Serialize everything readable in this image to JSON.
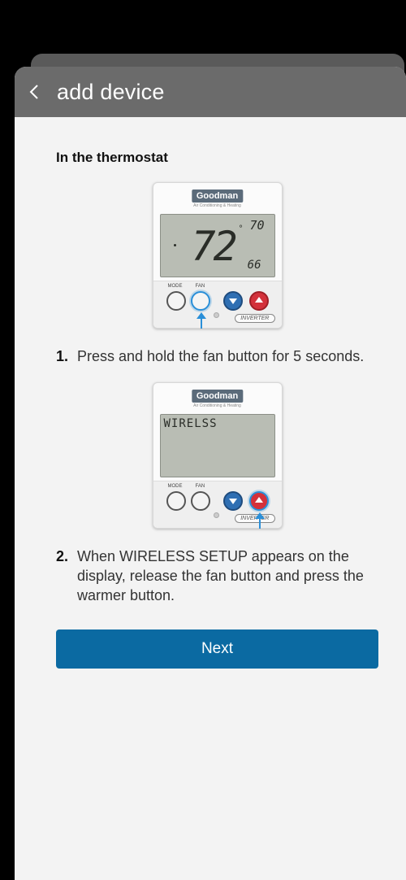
{
  "header": {
    "title": "add device",
    "back_icon": "chevron-left-icon"
  },
  "section_title": "In the thermostat",
  "thermostat_1": {
    "brand": "Goodman",
    "brand_sub": "Air Conditioning & Heating",
    "current_temp": "72",
    "set_high": "70",
    "set_low": "66",
    "mode_label": "MODE",
    "fan_label": "FAN",
    "badge": "INVERTER"
  },
  "step_1": {
    "number": "1.",
    "text": "Press and hold the fan button for 5 seconds."
  },
  "thermostat_2": {
    "brand": "Goodman",
    "brand_sub": "Air Conditioning & Heating",
    "display_text": "WIRELSS",
    "mode_label": "MODE",
    "fan_label": "FAN",
    "badge": "INVERTER"
  },
  "step_2": {
    "number": "2.",
    "text": "When WIRELESS SETUP appears on the display, release the fan button and press the warmer button."
  },
  "next_button": {
    "label": "Next"
  },
  "colors": {
    "accent": "#0b6aa2",
    "header": "#6b6b6b",
    "highlight": "#2a8fd8"
  }
}
